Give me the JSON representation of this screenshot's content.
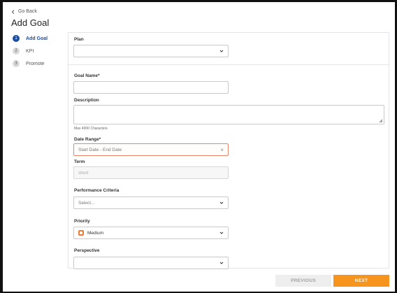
{
  "header": {
    "go_back": "Go Back",
    "title": "Add Goal"
  },
  "steps": [
    {
      "number": "1",
      "label": "Add Goal",
      "active": true
    },
    {
      "number": "2",
      "label": "KPI",
      "active": false
    },
    {
      "number": "3",
      "label": "Promote",
      "active": false
    }
  ],
  "form": {
    "plan": {
      "label": "Plan",
      "value": ""
    },
    "goal_name": {
      "label": "Goal Name*",
      "value": ""
    },
    "description": {
      "label": "Description",
      "value": "",
      "hint": "Max 4000 Characters"
    },
    "date_range": {
      "label": "Date Range*",
      "placeholder": "Start Date - End Date"
    },
    "term": {
      "label": "Term",
      "placeholder": "short"
    },
    "performance_criteria": {
      "label": "Performance Criteria",
      "placeholder": "Select..."
    },
    "priority": {
      "label": "Priority",
      "value": "Medium",
      "color": "#f07a3a"
    },
    "perspective": {
      "label": "Perspective",
      "value": ""
    }
  },
  "buttons": {
    "previous": "PREVIOUS",
    "next": "NEXT"
  },
  "colors": {
    "accent": "#1f4e9e",
    "primary_button": "#f7941d",
    "error_border": "#e8866b"
  }
}
